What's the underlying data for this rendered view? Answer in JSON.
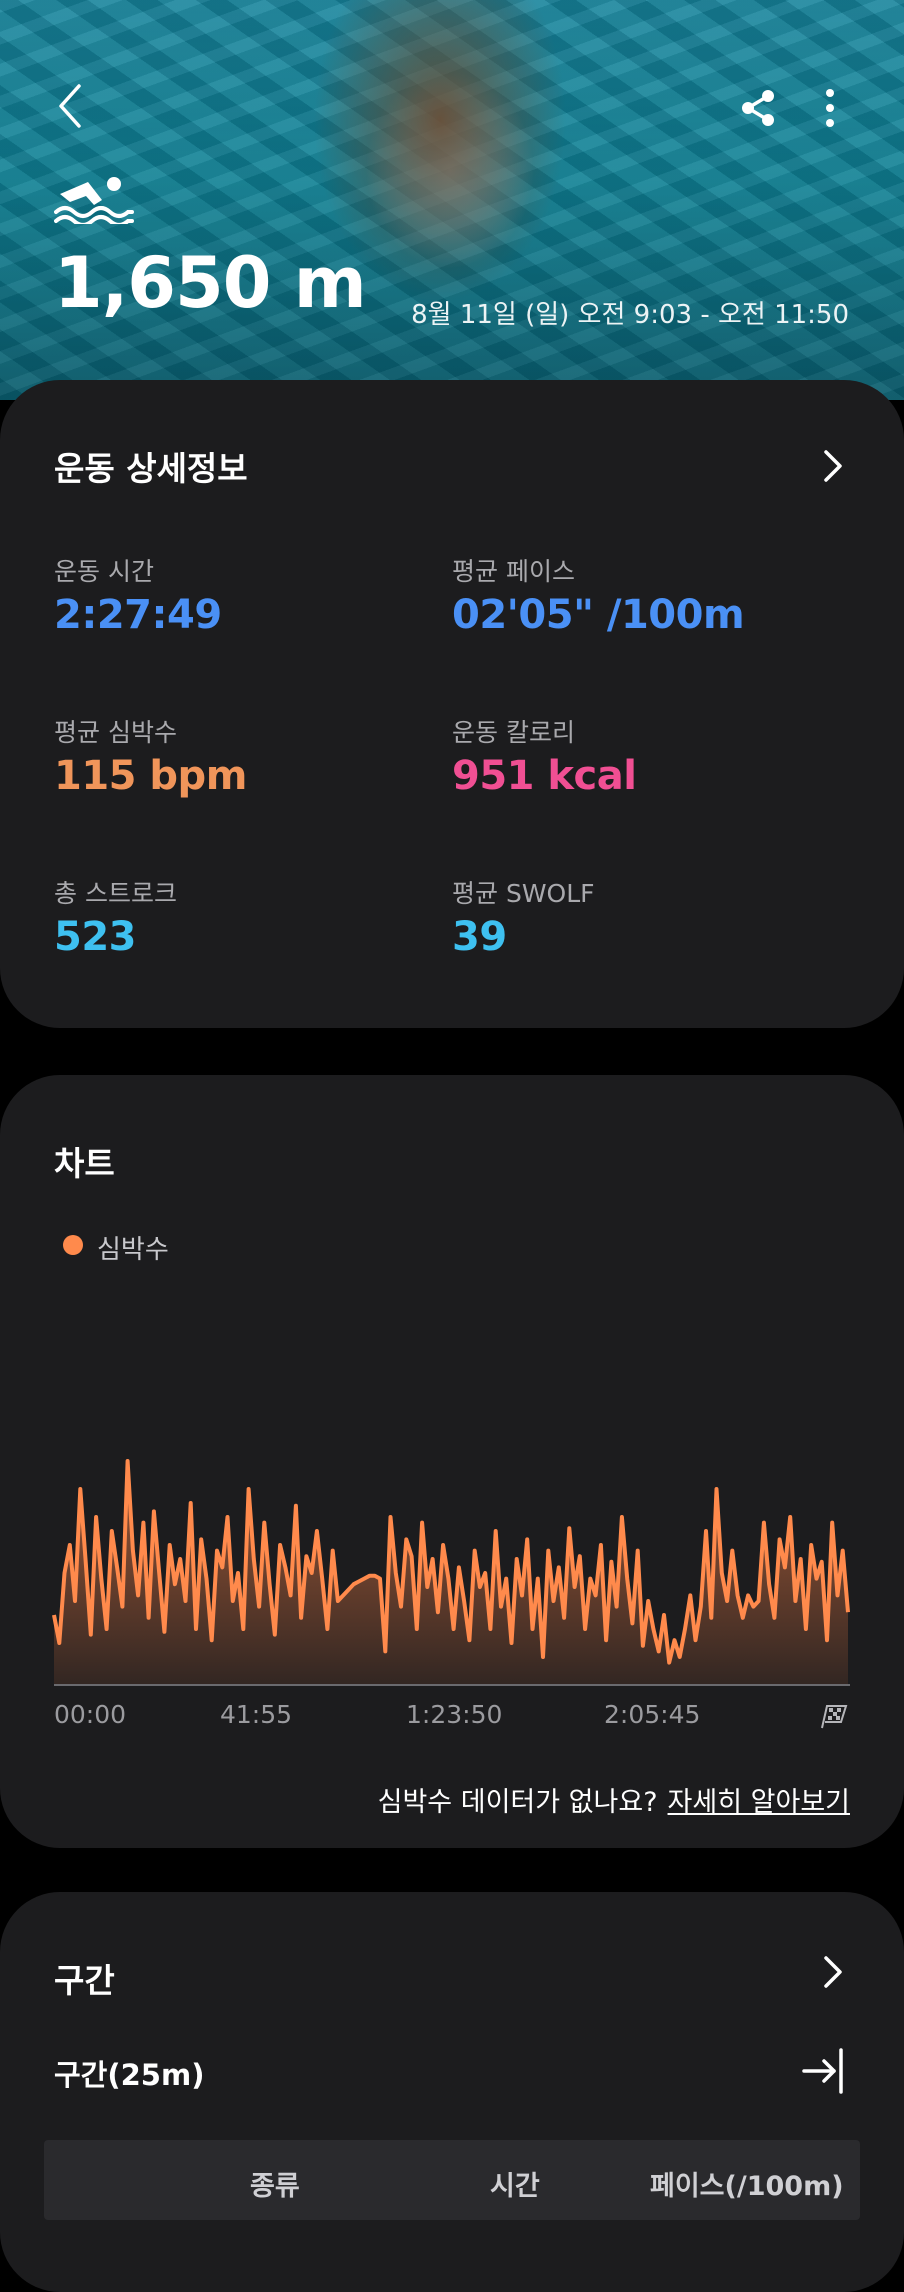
{
  "header": {
    "distance": "1,650 m",
    "date_range": "8월 11일 (일) 오전 9:03 - 오전 11:50",
    "icons": {
      "back": "chevron-left-icon",
      "share": "share-icon",
      "more": "more-vertical-icon",
      "activity": "swimming-icon"
    }
  },
  "details": {
    "title": "운동 상세정보",
    "stats": [
      {
        "label": "운동 시간",
        "value": "2:27:49",
        "color": "#4a90f5"
      },
      {
        "label": "평균 페이스",
        "value": "02'05\" /100m",
        "color": "#4a90f5"
      },
      {
        "label": "평균 심박수",
        "value": "115 bpm",
        "color": "#f0955a"
      },
      {
        "label": "운동 칼로리",
        "value": "951 kcal",
        "color": "#f04f93"
      },
      {
        "label": "총 스트로크",
        "value": "523",
        "color": "#3ec0f0"
      },
      {
        "label": "평균 SWOLF",
        "value": "39",
        "color": "#3ec0f0"
      }
    ]
  },
  "chart_section": {
    "title": "차트",
    "missing_text": "심박수 데이터가 없나요?",
    "learn_more": "자세히 알아보기"
  },
  "chart_data": {
    "type": "area",
    "series": [
      {
        "name": "심박수",
        "color": "#ff8a4c",
        "values": [
          105,
          95,
          120,
          130,
          110,
          150,
          125,
          98,
          140,
          118,
          100,
          135,
          122,
          108,
          160,
          128,
          112,
          138,
          104,
          142,
          120,
          99,
          130,
          116,
          125,
          110,
          145,
          100,
          132,
          118,
          96,
          128,
          122,
          140,
          110,
          120,
          100,
          150,
          125,
          108,
          138,
          116,
          98,
          130,
          122,
          112,
          144,
          104,
          126,
          120,
          135,
          118,
          100,
          128,
          110,
          112,
          114,
          116,
          117,
          118,
          119,
          119,
          118,
          92,
          140,
          120,
          108,
          132,
          126,
          100,
          138,
          115,
          125,
          106,
          130,
          118,
          100,
          122,
          110,
          96,
          128,
          115,
          120,
          100,
          135,
          108,
          118,
          95,
          125,
          112,
          132,
          100,
          118,
          90,
          128,
          110,
          122,
          104,
          136,
          115,
          126,
          100,
          118,
          112,
          130,
          96,
          124,
          108,
          140,
          118,
          102,
          128,
          94,
          110,
          100,
          92,
          105,
          88,
          96,
          90,
          100,
          112,
          96,
          108,
          135,
          104,
          150,
          120,
          110,
          128,
          112,
          104,
          112,
          108,
          110,
          138,
          116,
          104,
          132,
          122,
          140,
          110,
          125,
          100,
          130,
          118,
          124,
          96,
          138,
          112,
          128,
          106
        ]
      }
    ],
    "ylim": [
      80,
      180
    ],
    "x_ticks": [
      "00:00",
      "41:55",
      "1:23:50",
      "2:05:45"
    ],
    "legend": "top-left"
  },
  "segments": {
    "title": "구간",
    "subtitle": "구간(25m)",
    "columns": [
      "종류",
      "시간",
      "페이스(/100m)"
    ]
  }
}
